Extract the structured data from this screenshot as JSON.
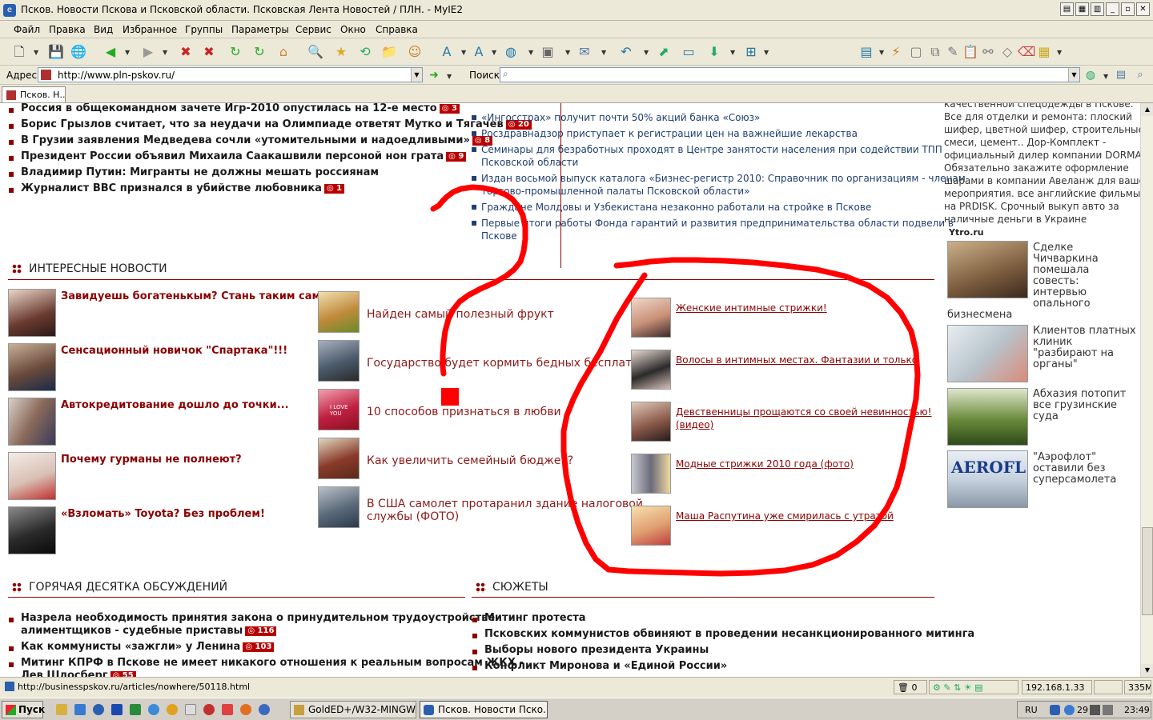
{
  "window": {
    "title": "Псков. Новости Пскова и Псковской области. Псковская Лента Новостей / ПЛН. - MyIE2"
  },
  "menu": [
    "Файл",
    "Правка",
    "Вид",
    "Избранное",
    "Группы",
    "Параметры",
    "Сервис",
    "Окно",
    "Справка"
  ],
  "address": {
    "label": "Адрес",
    "url": "http://www.pln-pskov.ru/",
    "search_label": "Поиск"
  },
  "tab": {
    "label": "Псков. Н..."
  },
  "top_news_left": [
    {
      "text": "Россия в общекомандном зачете Игр-2010 опустилась на 12-е место",
      "count": "3"
    },
    {
      "text": "Борис Грызлов считает, что за неудачи на Олимпиаде ответят Мутко и Тягачев",
      "count": "20"
    },
    {
      "text": "В Грузии заявления Медведева сочли «утомительными и надоедливыми»",
      "count": "8"
    },
    {
      "text": "Президент России объявил Михаила Саакашвили персоной нон грата",
      "count": "9"
    },
    {
      "text": "Владимир Путин: Мигранты не должны мешать россиянам",
      "count": ""
    },
    {
      "text": "Журналист BBC признался в убийстве любовника",
      "count": "1"
    }
  ],
  "top_news_right": [
    {
      "l1": "«Ингосстрах» получит почти 50% акций банка «Союз»",
      "l2": ""
    },
    {
      "l1": "Росздравнадзор приступает к регистрации цен на важнейшие лекарства",
      "l2": ""
    },
    {
      "l1": "Семинары для безработных проходят в Центре занятости населения при содействии ТПП",
      "l2": "Псковской области"
    },
    {
      "l1": "Издан восьмой выпуск каталога «Бизнес-регистр 2010: Справочник по организациям - членам",
      "l2": "торгово-промышленной палаты Псковской области»"
    },
    {
      "l1": "Граждане Молдовы и Узбекистана незаконно работали на стройке в Пскове",
      "l2": ""
    },
    {
      "l1": "Первые итоги работы Фонда гарантий и развития предпринимательства области подвели в",
      "l2": "Пскове"
    }
  ],
  "sidebar_ad": {
    "lines": [
      "качественной спецодежды в Пскове.",
      "Все для отделки и ремонта: плоский",
      "шифер, цветной шифер, строительные",
      "смеси, цемент.. Дор-Комплект -",
      "официальный дилер компании DORMA.",
      "Обязательно закажите оформление",
      "шарами в компании Авеланж для вашего",
      "мероприятия. все английские фильмы",
      "на PRDISK. Срочный выкуп авто за",
      "наличные деньги в Украине"
    ],
    "source": "Ytro.ru"
  },
  "sidebar_news": [
    {
      "lines": [
        "Сделке",
        "Чичваркина",
        "помешала",
        "совесть:",
        "интервью",
        "опального"
      ],
      "tail": "бизнесмена"
    },
    {
      "lines": [
        "Клиентов платных",
        "клиник",
        "\"разбирают на",
        "органы\""
      ],
      "tail": ""
    },
    {
      "lines": [
        "Абхазия потопит",
        "все грузинские",
        "суда"
      ],
      "tail": ""
    },
    {
      "lines": [
        "\"Аэрофлот\"",
        "оставили без",
        "суперсамолета"
      ],
      "tail": ""
    }
  ],
  "interesting": {
    "header": "ИНТЕРЕСНЫЕ НОВОСТИ",
    "col1": [
      "Завидуешь богатенькым? Стань таким сам!",
      "Сенсационный новичок \"Спартака\"!!!",
      "Автокредитование дошло до точки...",
      "Почему гурманы не полнеют?",
      "«Взломать» Toyota? Без проблем!"
    ],
    "col2": [
      [
        "Найден самый полезный фрукт",
        ""
      ],
      [
        "Государство будет кормить бедных бесплатно",
        ""
      ],
      [
        "10 способов признаться в любви",
        ""
      ],
      [
        "Как увеличить семейный бюджет?",
        ""
      ],
      [
        "В США самолет протаранил здание налоговой",
        "службы (ФОТО)"
      ]
    ],
    "col3": [
      [
        "Женские интимные стрижки!",
        ""
      ],
      [
        "Волосы в интимных местах. Фантазии и только",
        ""
      ],
      [
        "Девственницы прощаются со своей невинностью!",
        "(видео)"
      ],
      [
        "Модные стрижки 2010 года (фото)",
        ""
      ],
      [
        "Маша Распутина уже смирилась с утратой",
        ""
      ]
    ]
  },
  "hot": {
    "header": "ГОРЯЧАЯ ДЕСЯТКА ОБСУЖДЕНИЙ",
    "items": [
      {
        "l1": "Назрела необходимость принятия закона о принудительном трудоустройстве",
        "l2": "алиментщиков - судебные приставы",
        "count": "116"
      },
      {
        "l1": "Как коммунисты «зажгли» у Ленина",
        "l2": "",
        "count": "103"
      },
      {
        "l1": "Митинг КПРФ в Пскове не имеет никакого отношения к реальным вопросам ЖКХ -",
        "l2": "Лев Шлосберг",
        "count": "55"
      }
    ]
  },
  "stories": {
    "header": "СЮЖЕТЫ",
    "items": [
      "Митинг протеста",
      "Псковских коммунистов обвиняют в проведении несанкционированного митинга",
      "Выборы нового президента Украины",
      "Конфликт Миронова и «Единой России»"
    ]
  },
  "status": {
    "url": "http://businesspskov.ru/articles/nowhere/50118.html",
    "blocked": "0",
    "ip": "192.168.1.33",
    "mem": "335M"
  },
  "taskbar": {
    "start": "Пуск",
    "tasks": [
      "GoldED+/W32-MINGW...",
      "Псков. Новости Пско..."
    ],
    "lang": "RU",
    "clock": "23:49",
    "tray_num": "29"
  },
  "colors": {
    "accent": "#8b0000",
    "link_blue": "#1f3f6f",
    "scribble": "#ff0000"
  }
}
